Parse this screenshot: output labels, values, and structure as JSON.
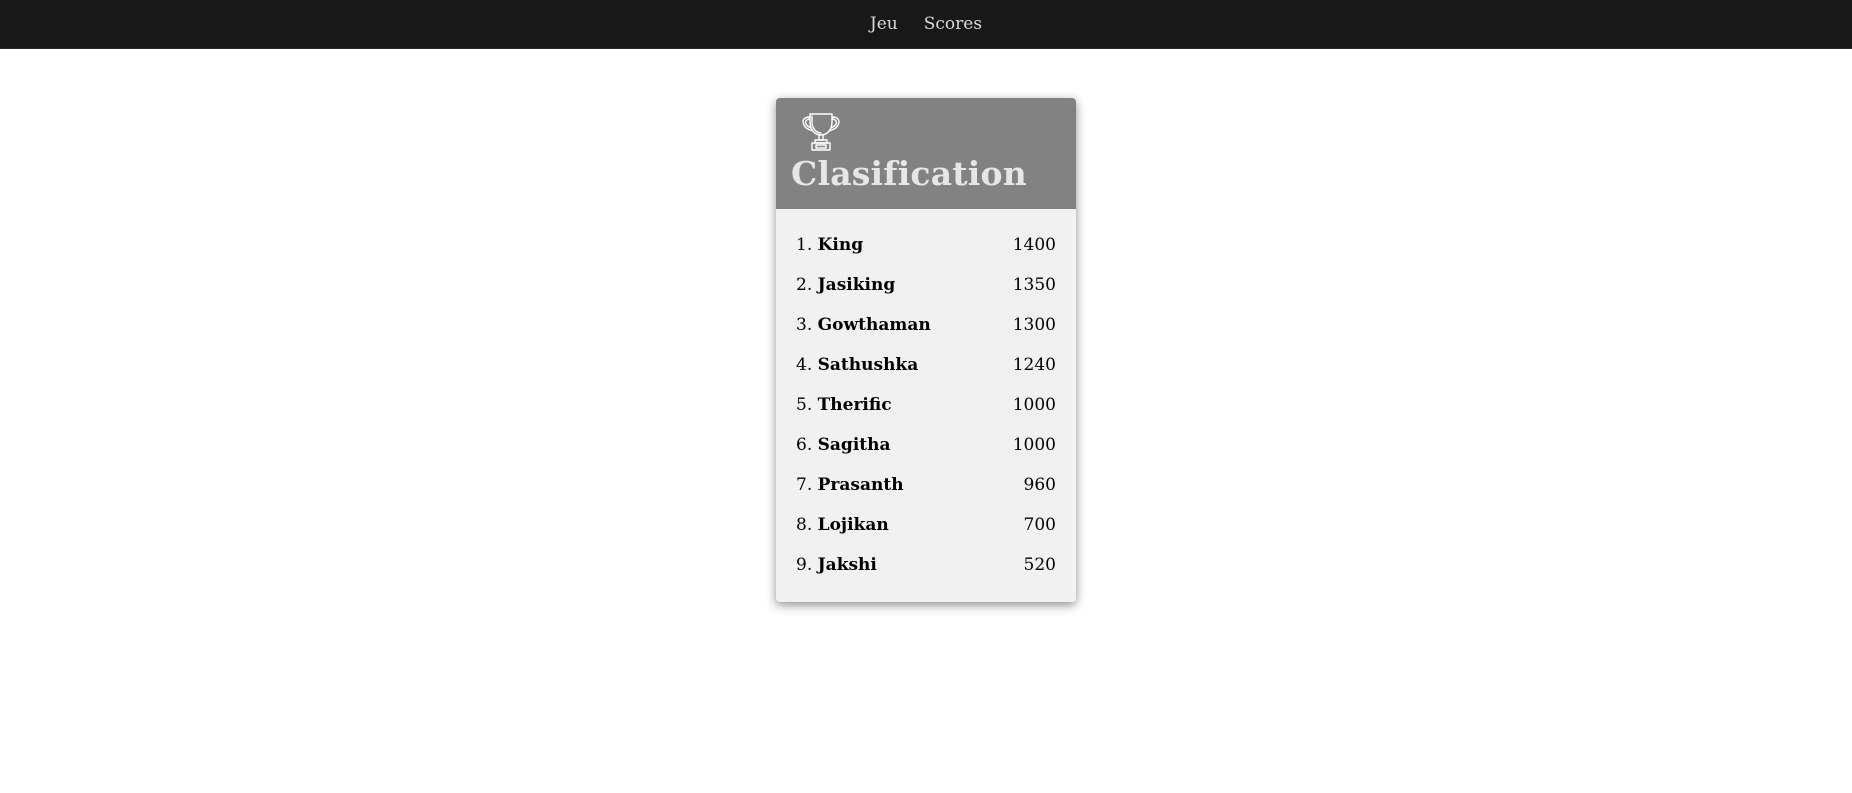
{
  "nav": {
    "items": [
      {
        "label": "Jeu"
      },
      {
        "label": "Scores"
      }
    ]
  },
  "card": {
    "icon": "trophy-icon",
    "title": "Clasification",
    "header_color": "#828282",
    "body_color": "#f1f1f1"
  },
  "ranking": [
    {
      "rank": "1.",
      "name": "King",
      "score": "1400"
    },
    {
      "rank": "2.",
      "name": "Jasiking",
      "score": "1350"
    },
    {
      "rank": "3.",
      "name": "Gowthaman",
      "score": "1300"
    },
    {
      "rank": "4.",
      "name": "Sathushka",
      "score": "1240"
    },
    {
      "rank": "5.",
      "name": "Therific",
      "score": "1000"
    },
    {
      "rank": "6.",
      "name": "Sagitha",
      "score": "1000"
    },
    {
      "rank": "7.",
      "name": "Prasanth",
      "score": "960"
    },
    {
      "rank": "8.",
      "name": "Lojikan",
      "score": "700"
    },
    {
      "rank": "9.",
      "name": "Jakshi",
      "score": "520"
    }
  ]
}
